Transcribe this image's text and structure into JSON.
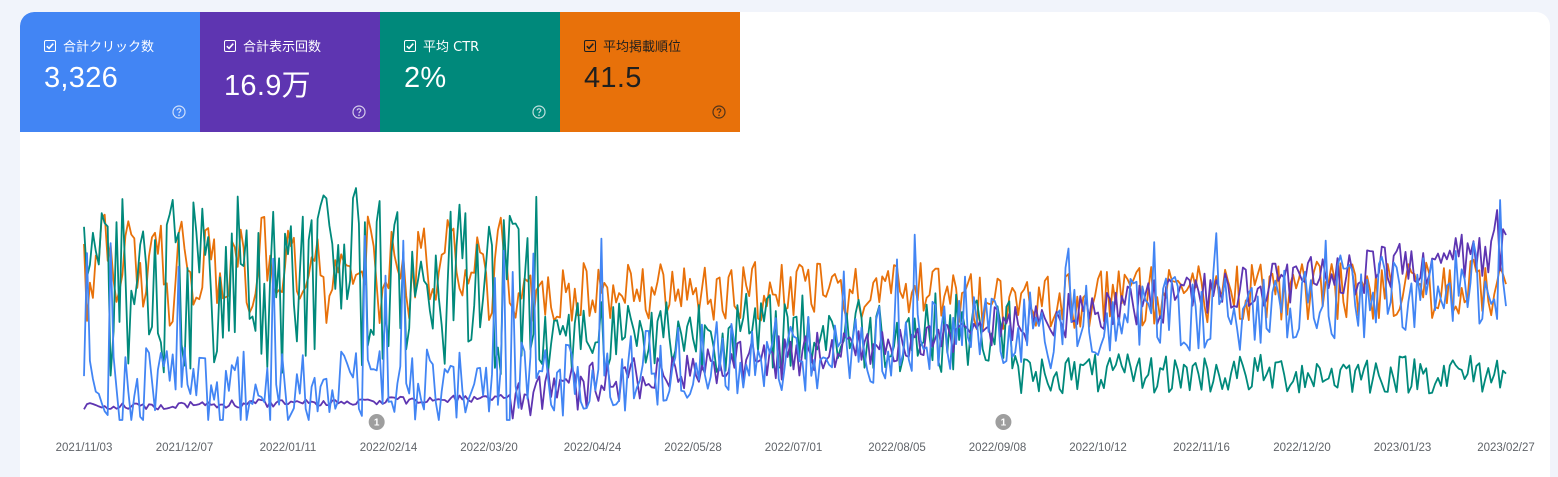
{
  "colors": {
    "clicks": "#4285f4",
    "impressions": "#5e35b1",
    "ctr": "#00897b",
    "position": "#e8710a",
    "annotation": "#9e9e9e"
  },
  "metrics": {
    "clicks": {
      "label": "合計クリック数",
      "value": "3,326",
      "checked": true
    },
    "impressions": {
      "label": "合計表示回数",
      "value": "16.9万",
      "checked": true
    },
    "ctr": {
      "label": "平均 CTR",
      "value": "2%",
      "checked": true
    },
    "position": {
      "label": "平均掲載順位",
      "value": "41.5",
      "checked": true
    }
  },
  "chart_data": {
    "type": "line",
    "x_start": "2021/11/03",
    "x_end": "2023/02/27",
    "x_ticks": [
      "2021/11/03",
      "2021/12/07",
      "2022/01/11",
      "2022/02/14",
      "2022/03/20",
      "2022/04/24",
      "2022/05/28",
      "2022/07/01",
      "2022/08/05",
      "2022/09/08",
      "2022/10/12",
      "2022/11/16",
      "2022/12/20",
      "2023/01/23",
      "2023/02/27"
    ],
    "annotations": [
      {
        "date": "2022/02/10",
        "label": "1"
      },
      {
        "date": "2022/09/10",
        "label": "1"
      }
    ],
    "series": [
      {
        "key": "position",
        "color": "#e8710a"
      },
      {
        "key": "ctr",
        "color": "#00897b"
      },
      {
        "key": "impressions",
        "color": "#5e35b1"
      },
      {
        "key": "clicks",
        "color": "#4285f4"
      }
    ]
  }
}
